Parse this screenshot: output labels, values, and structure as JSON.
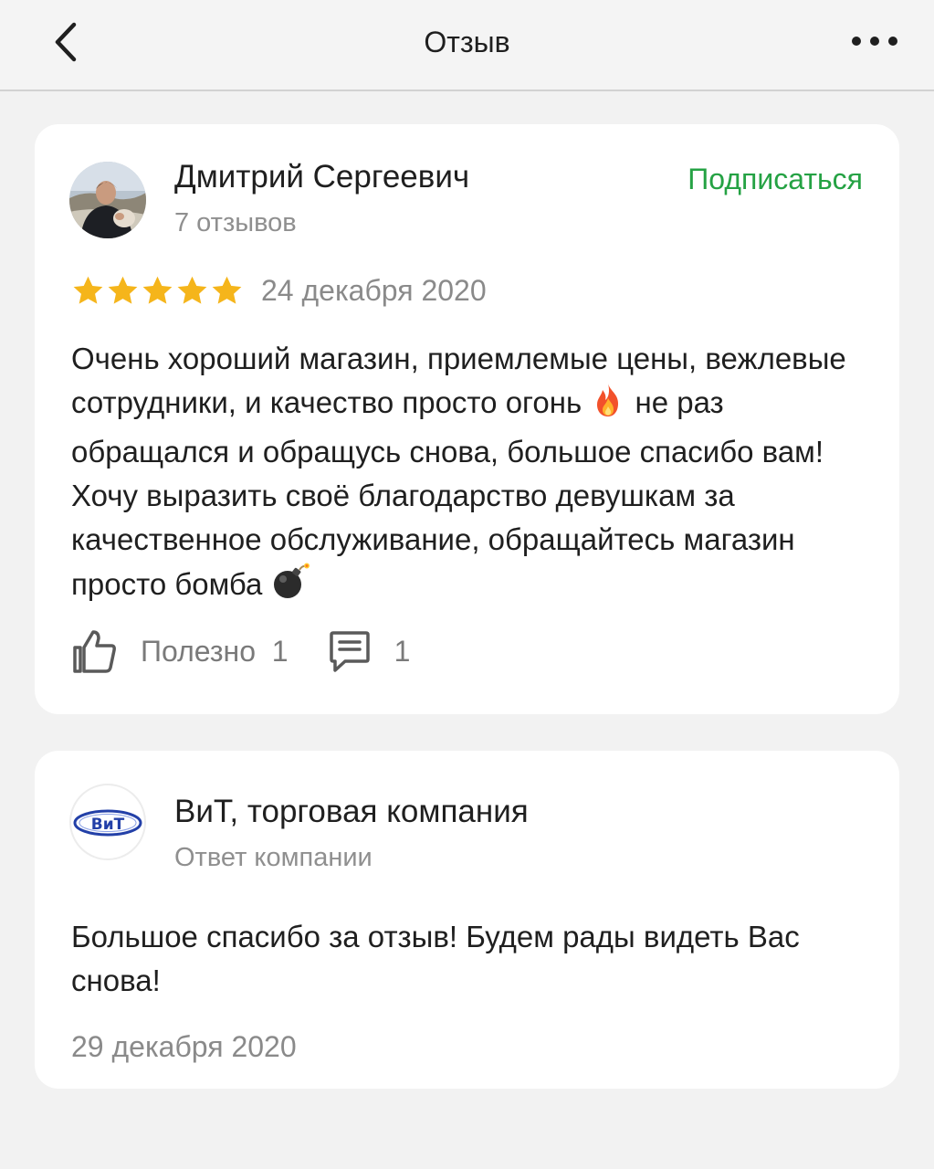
{
  "header": {
    "title": "Отзыв",
    "back_icon": "chevron-left-icon",
    "more_icon": "more-dots-icon"
  },
  "review": {
    "author": "Дмитрий Сергеевич",
    "author_reviews": "7 отзывов",
    "subscribe_label": "Подписаться",
    "rating": 5,
    "rating_max": 5,
    "date": "24 декабря 2020",
    "text_part1": "Очень хороший магазин, приемлемые цены, вежлевые сотрудники, и качество просто огонь ",
    "emoji1": "🔥",
    "text_part2": " не раз обращался и обращусь снова, большое спасибо вам! Хочу выразить своё благодарство девушкам за качественное обслуживание, обращайтесь магазин просто бомба ",
    "emoji2": "💣",
    "useful_label": "Полезно",
    "useful_count": "1",
    "comments_count": "1"
  },
  "reply": {
    "company": "ВиТ, торговая компания",
    "subtitle": "Ответ компании",
    "logo_text": "ВиТ",
    "text": "Большое спасибо за отзыв! Будем рады видеть Вас снова!",
    "date": "29 декабря 2020"
  },
  "colors": {
    "accent_green": "#25a244",
    "star_gold": "#f5b51b",
    "muted_text": "#8a8a8a",
    "logo_blue": "#2340a8"
  }
}
